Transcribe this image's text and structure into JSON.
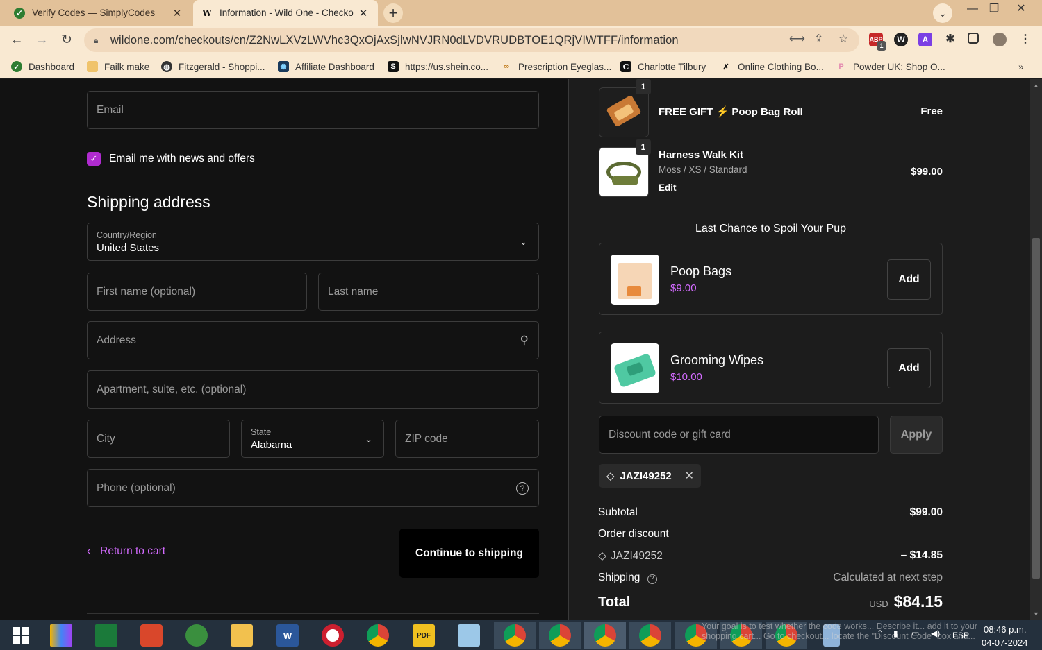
{
  "browser": {
    "tabs": [
      {
        "title": "Verify Codes — SimplyCodes",
        "active": false
      },
      {
        "title": "Information - Wild One - Checko",
        "active": true
      }
    ],
    "url": "wildone.com/checkouts/cn/Z2NwLXVzLWVhc3QxOjAxSjlwNVJRN0dLVDVRUDBTOE1QRjVIWTFF/information",
    "bookmarks": [
      "Dashboard",
      "Failk make",
      "Fitzgerald - Shoppi...",
      "Affiliate Dashboard",
      "https://us.shein.co...",
      "Prescription Eyeglas...",
      "Charlotte Tilbury",
      "Online Clothing Bo...",
      "Powder UK: Shop O..."
    ],
    "extension_badge": "1",
    "more_bookmarks": "»"
  },
  "form": {
    "email_placeholder": "Email",
    "newsletter_label": "Email me with news and offers",
    "shipping_title": "Shipping address",
    "country_label": "Country/Region",
    "country_value": "United States",
    "first_name_placeholder": "First name (optional)",
    "last_name_placeholder": "Last name",
    "address_placeholder": "Address",
    "apartment_placeholder": "Apartment, suite, etc. (optional)",
    "city_placeholder": "City",
    "state_label": "State",
    "state_value": "Alabama",
    "zip_placeholder": "ZIP code",
    "phone_placeholder": "Phone (optional)",
    "return_link": "Return to cart",
    "continue_button": "Continue to shipping"
  },
  "cart": {
    "items": [
      {
        "qty": "1",
        "name": "FREE GIFT ⚡ Poop Bag Roll",
        "price": "Free"
      },
      {
        "qty": "1",
        "name": "Harness Walk Kit",
        "variant": "Moss / XS / Standard",
        "edit": "Edit",
        "price": "$99.00"
      }
    ],
    "upsell_title": "Last Chance to Spoil Your Pup",
    "upsells": [
      {
        "name": "Poop Bags",
        "price": "$9.00",
        "add": "Add"
      },
      {
        "name": "Grooming Wipes",
        "price": "$10.00",
        "add": "Add"
      }
    ],
    "discount_placeholder": "Discount code or gift card",
    "apply_button": "Apply",
    "applied_code": "JAZI49252",
    "summary": {
      "subtotal_label": "Subtotal",
      "subtotal_value": "$99.00",
      "order_discount_label": "Order discount",
      "discount_code": "JAZI49252",
      "discount_value": "– $14.85",
      "shipping_label": "Shipping",
      "shipping_value": "Calculated at next step",
      "total_label": "Total",
      "currency": "USD",
      "total_value": "$84.15"
    }
  },
  "taskbar": {
    "time": "08:46 p.m.",
    "date": "04-07-2024",
    "lang": "ESP",
    "notification_text": "Your goal is to test whether the code works... Describe it... add it to your shopping cart... Go to checkout... locate the \"Discount Code\" box and..."
  },
  "colors": {
    "accent": "#b02bd0",
    "link": "#d36bff",
    "page_bg": "#121212",
    "panel_bg": "#1c1c1c",
    "browser_chrome": "#f9e9d2"
  }
}
